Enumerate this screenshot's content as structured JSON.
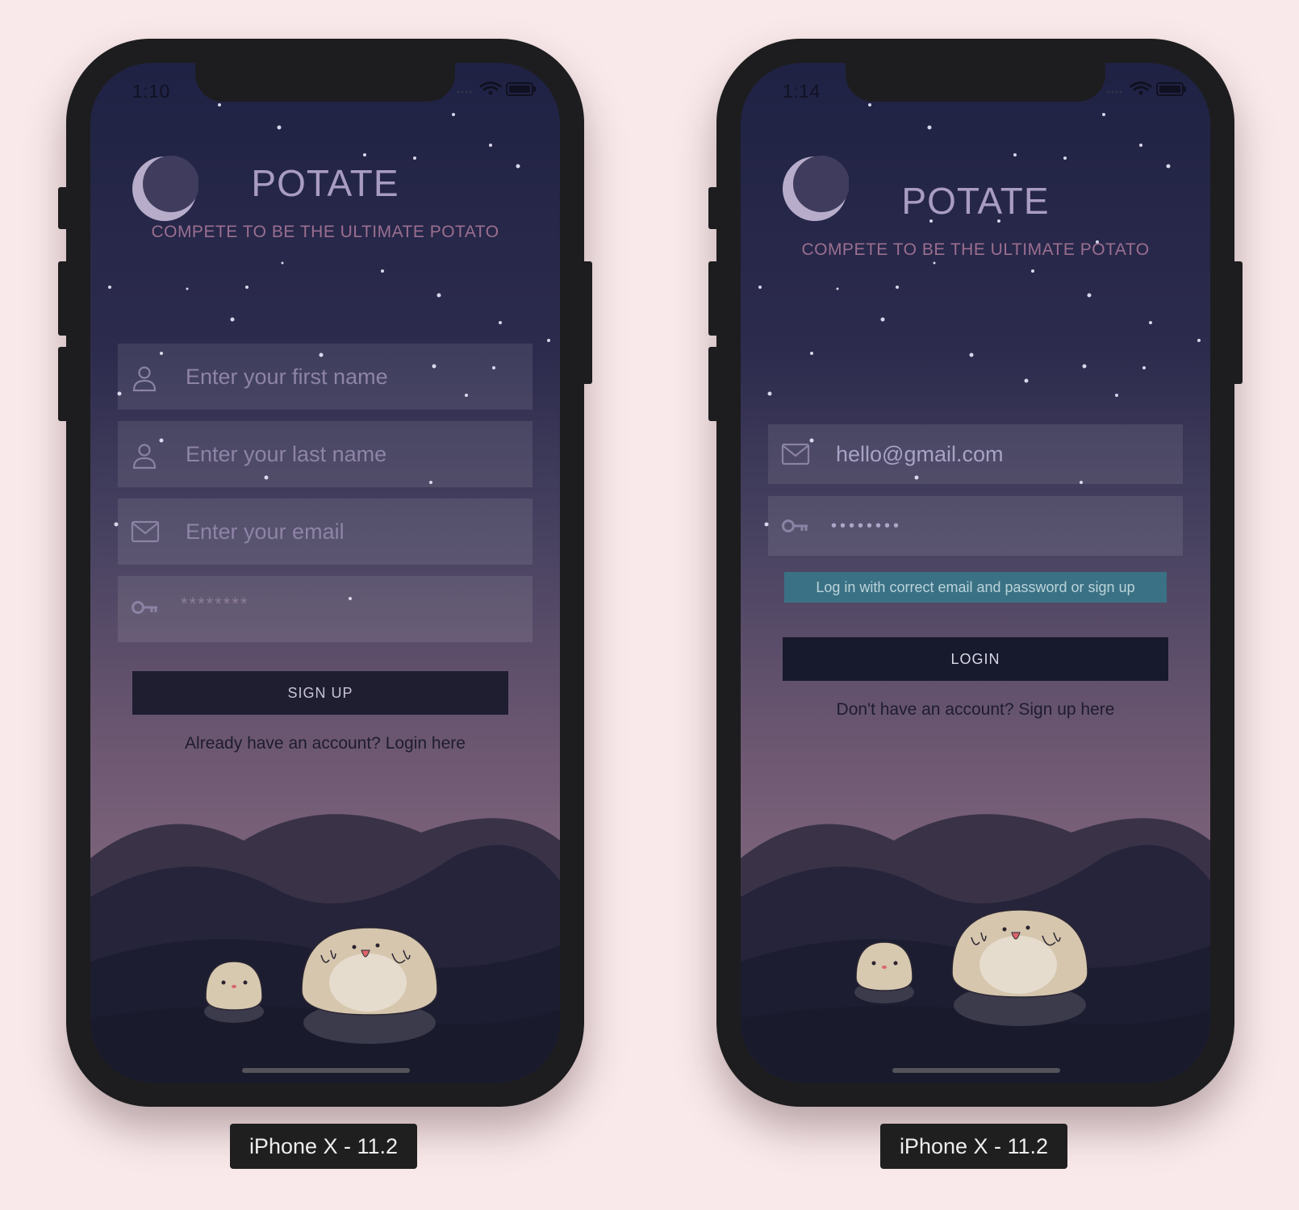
{
  "signup_screen": {
    "status": {
      "time": "1:10"
    },
    "app": {
      "title": "POTATE",
      "subtitle": "COMPETE TO BE THE ULTIMATE POTATO"
    },
    "fields": {
      "first_name": {
        "placeholder": "Enter your first name",
        "icon": "user-icon"
      },
      "last_name": {
        "placeholder": "Enter your last name",
        "icon": "user-icon"
      },
      "email": {
        "placeholder": "Enter your email",
        "icon": "mail-icon"
      },
      "password": {
        "placeholder": "********",
        "icon": "key-icon"
      }
    },
    "submit_label": "SIGN UP",
    "switch_link": "Already have an account? Login here"
  },
  "login_screen": {
    "status": {
      "time": "1:14"
    },
    "app": {
      "title": "POTATE",
      "subtitle": "COMPETE TO BE THE ULTIMATE POTATO"
    },
    "fields": {
      "email": {
        "value": "hello@gmail.com",
        "icon": "mail-icon"
      },
      "password": {
        "value": "••••••••",
        "icon": "key-icon"
      }
    },
    "error_message": "Log in with correct email and password or sign up",
    "submit_label": "LOGIN",
    "switch_link": "Don't have an account? Sign up here"
  },
  "device_labels": [
    "iPhone X - 11.2",
    "iPhone X - 11.2"
  ],
  "colors": {
    "page_background": "#f9e9ea",
    "title": "#a99cc2",
    "subtitle": "#9b6f90",
    "error_background": "#3b7184",
    "button": "#1f1e31"
  }
}
